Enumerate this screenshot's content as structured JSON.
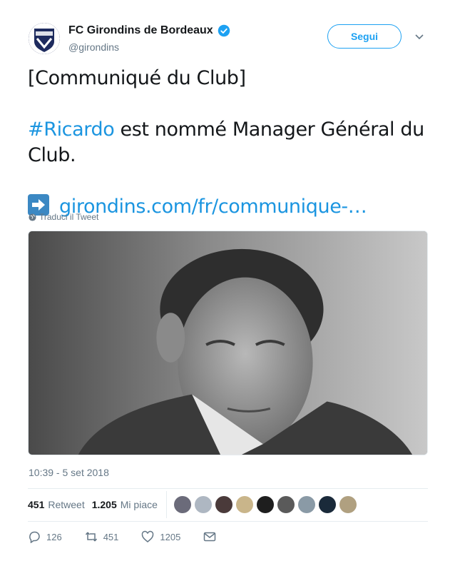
{
  "account": {
    "name": "FC Girondins de Bordeaux",
    "handle": "@girondins",
    "follow_label": "Segui",
    "avatar_text": "GIRONDINS DE BORDEAUX"
  },
  "tweet": {
    "line1": "[Communiqué du Club]",
    "hashtag": "#Ricardo",
    "line2_rest": " est nommé Manager Général du",
    "line3": "Club.",
    "link": "girondins.com/fr/communique-…",
    "translate": "Traduci il Tweet",
    "timestamp": "10:39 - 5 set 2018"
  },
  "stats": {
    "retweets_count": "451",
    "retweets_label": "Retweet",
    "likes_count": "1.205",
    "likes_label": "Mi piace",
    "face_colors": [
      "#6b6b7a",
      "#aeb7c2",
      "#4a3a3a",
      "#c9b58a",
      "#1e1e1e",
      "#5a5a5a",
      "#8a9aa6",
      "#1a2a3a",
      "#b0a080"
    ]
  },
  "actions": {
    "replies": "126",
    "retweets": "451",
    "likes": "1205"
  },
  "colors": {
    "accent": "#1da1f2",
    "link": "#1b95e0",
    "muted": "#657786"
  }
}
